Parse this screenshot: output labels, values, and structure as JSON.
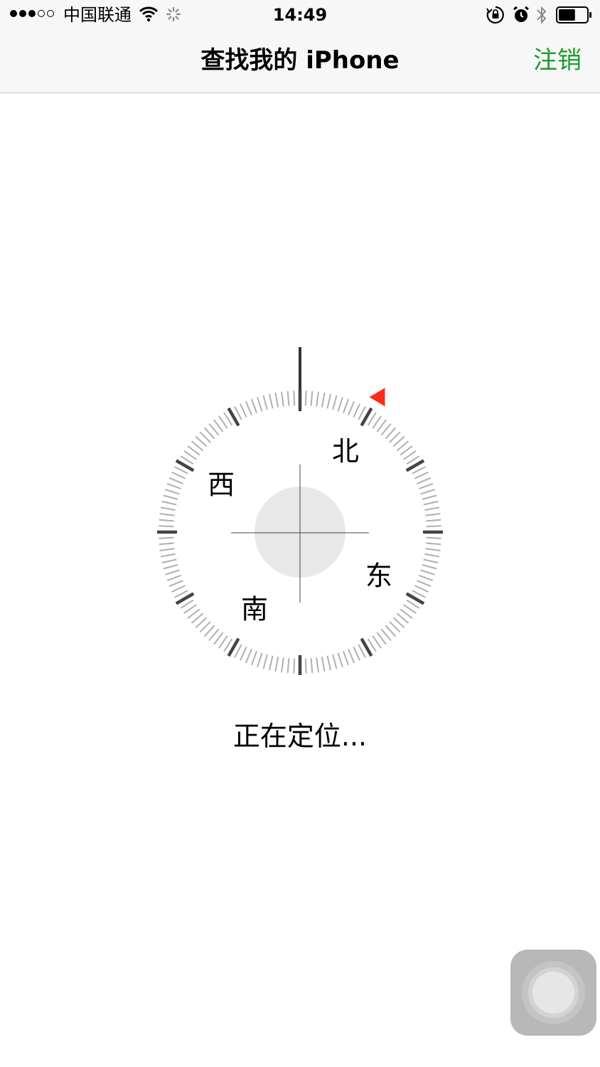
{
  "status_bar": {
    "signal_strength": 3,
    "signal_max": 5,
    "carrier": "中国联通",
    "time": "14:49",
    "battery_level": 0.6,
    "icons": [
      "wifi-icon",
      "activity-spinner-icon",
      "rotation-lock-icon",
      "alarm-icon",
      "bluetooth-icon",
      "battery-icon"
    ]
  },
  "nav": {
    "title": "查找我的 iPhone",
    "logout_label": "注销",
    "accent_color": "#1d9b2e"
  },
  "compass": {
    "labels": {
      "north": "北",
      "east": "东",
      "south": "南",
      "west": "西"
    },
    "north_angle_deg": 30,
    "indicator_color": "#ff2a1a"
  },
  "status_text": "正在定位..."
}
